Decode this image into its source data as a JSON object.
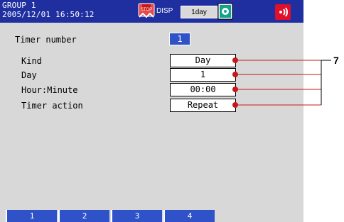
{
  "header": {
    "group_name": "GROUP 1",
    "datetime": "2005/12/01 16:50:12",
    "disp_label": "DISP",
    "interval": "1day",
    "icons": {
      "stop": "stop-icon",
      "media": "media-icon",
      "alarm": "alarm-icon"
    }
  },
  "form": {
    "timer_number_label": "Timer number",
    "timer_number_value": "1",
    "rows": [
      {
        "label": "Kind",
        "value": "Day"
      },
      {
        "label": "Day",
        "value": "1"
      },
      {
        "label": "Hour:Minute",
        "value": "00:00"
      },
      {
        "label": "Timer action",
        "value": "Repeat"
      }
    ]
  },
  "softkeys": [
    "1",
    "2",
    "3",
    "4"
  ],
  "callout": {
    "number": "7",
    "color": "#c8181a"
  },
  "colors": {
    "title_bar": "#1f2fa0",
    "screen_bg": "#d8d8d8",
    "highlight": "#2f52c8",
    "alarm": "#e0102a"
  }
}
